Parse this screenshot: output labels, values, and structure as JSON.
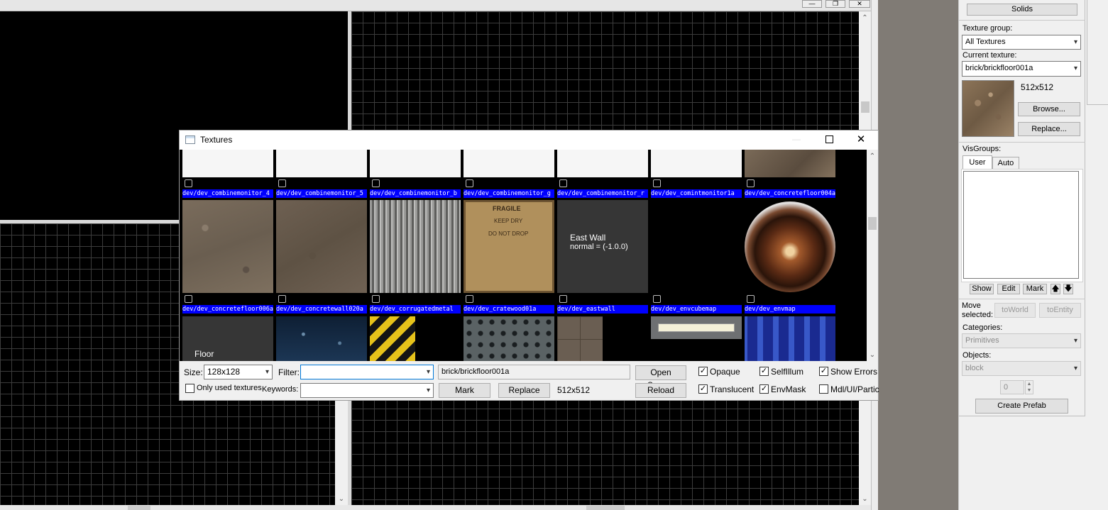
{
  "main": {
    "window_controls": [
      "minimize-icon",
      "restore-icon",
      "close-icon"
    ]
  },
  "right_panel": {
    "solids_button": "Solids",
    "texture_group_label": "Texture group:",
    "texture_group_value": "All Textures",
    "current_texture_label": "Current texture:",
    "current_texture_value": "brick/brickfloor001a",
    "texture_size": "512x512",
    "browse_button": "Browse...",
    "replace_button": "Replace...",
    "visgroups_label": "VisGroups:",
    "tabs": [
      "User",
      "Auto"
    ],
    "show_button": "Show",
    "edit_button": "Edit",
    "mark_button": "Mark",
    "move_selected_label": "Move selected:",
    "to_world_button": "toWorld",
    "to_entity_button": "toEntity",
    "categories_label": "Categories:",
    "categories_value": "Primitives",
    "objects_label": "Objects:",
    "objects_value": "block",
    "spinner_value": "0",
    "create_prefab_button": "Create Prefab"
  },
  "textures_window": {
    "title": "Textures",
    "row1_names": [
      "dev/dev_combinemonitor_4",
      "dev/dev_combinemonitor_5",
      "dev/dev_combinemonitor_b",
      "dev/dev_combinemonitor_g",
      "dev/dev_combinemonitor_r",
      "dev/dev_comintmonitor1a",
      "dev/dev_concretefloor004a"
    ],
    "row2_names": [
      "dev/dev_concretefloor006a",
      "dev/dev_concretewall020a",
      "dev/dev_corrugatedmetal",
      "dev/dev_cratewood01a",
      "dev/dev_eastwall",
      "dev/dev_envcubemap",
      "dev/dev_envmap"
    ],
    "crate_text": [
      "FRAGILE",
      "KEEP DRY",
      "DO NOT DROP"
    ],
    "eastwall_text": [
      "East Wall",
      "normal = (-1.0.0)"
    ],
    "floor_text": "Floor",
    "size_label": "Size:",
    "size_value": "128x128",
    "filter_label": "Filter:",
    "filter_value": "",
    "keywords_label": "Keywords:",
    "keywords_value": "",
    "only_used_label": "Only used textures",
    "current_texture": "brick/brickfloor001a",
    "open_source_button": "Open Source",
    "reload_button": "Reload",
    "mark_button": "Mark",
    "replace_button": "Replace",
    "dimensions": "512x512",
    "opaque_label": "Opaque",
    "selfillum_label": "SelfIllum",
    "show_errors_label": "Show Errors",
    "translucent_label": "Translucent",
    "envmask_label": "EnvMask",
    "mdl_label": "Mdl/UI/Partic",
    "checks": {
      "opaque": true,
      "selfillum": true,
      "show_errors": true,
      "translucent": true,
      "envmask": true,
      "mdl": false,
      "only_used": false
    }
  },
  "colors": {
    "name_bar": "#0000ff",
    "viewport_bg": "#000000"
  }
}
